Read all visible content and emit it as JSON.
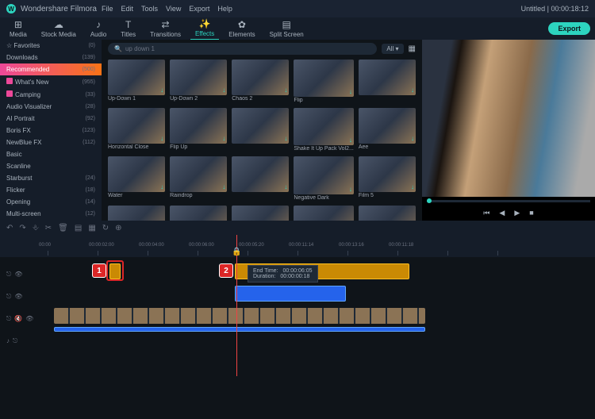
{
  "app_name": "Wondershare Filmora",
  "menu": [
    "File",
    "Edit",
    "Tools",
    "View",
    "Export",
    "Help"
  ],
  "project": {
    "title": "Untitled",
    "duration": "00:00:18:12"
  },
  "tabs": [
    {
      "icon": "⊞",
      "label": "Media"
    },
    {
      "icon": "☁",
      "label": "Stock Media"
    },
    {
      "icon": "♪",
      "label": "Audio"
    },
    {
      "icon": "T",
      "label": "Titles"
    },
    {
      "icon": "⇄",
      "label": "Transitions"
    },
    {
      "icon": "✨",
      "label": "Effects"
    },
    {
      "icon": "✿",
      "label": "Elements"
    },
    {
      "icon": "▤",
      "label": "Split Screen"
    }
  ],
  "export_label": "Export",
  "sidebar": {
    "favorites": "Favorites",
    "favorites_count": "(0)",
    "items": [
      {
        "label": "Downloads",
        "count": "(139)"
      },
      {
        "label": "Recommended",
        "count": "(500)",
        "class": "rec"
      },
      {
        "label": "What's New",
        "count": "(955)",
        "tag": true
      },
      {
        "label": "Camping",
        "count": "(33)",
        "tag": true
      },
      {
        "label": "Audio Visualizer",
        "count": "(28)"
      },
      {
        "label": "AI Portrait",
        "count": "(92)"
      },
      {
        "label": "Boris FX",
        "count": "(123)"
      },
      {
        "label": "NewBlue FX",
        "count": "(112)"
      },
      {
        "label": "Basic",
        "count": ""
      },
      {
        "label": "Scanline",
        "count": ""
      },
      {
        "label": "Starburst",
        "count": "(24)"
      },
      {
        "label": "Flicker",
        "count": "(18)"
      },
      {
        "label": "Opening",
        "count": "(14)"
      },
      {
        "label": "Multi-screen",
        "count": "(12)"
      }
    ]
  },
  "search": {
    "placeholder": "up down 1"
  },
  "filter": "All",
  "effects": [
    "Up-Down 1",
    "Up-Down 2",
    "Chaos 2",
    "Flip",
    "",
    "Horizontal Close",
    "Flip Up",
    "",
    "Shake It Up Pack Vol2...",
    "Aee",
    "Water",
    "Raindrop",
    "",
    "Negative Dark",
    "Film 5",
    "",
    "",
    "",
    "",
    ""
  ],
  "preview": {
    "controls": [
      "⏮",
      "◀",
      "▶",
      "■"
    ]
  },
  "toolbar_icons": [
    "↶",
    "↷",
    "⎀",
    "✂",
    "🗑",
    "▤",
    "▦",
    "↻",
    "⊕"
  ],
  "ruler": [
    "00:00",
    "00:00:02:00",
    "00:00:04:00",
    "00:00:06:00",
    "00:00:05:20",
    "00:00:11:14",
    "00:00:13:16",
    "00:00:11:18",
    "",
    ""
  ],
  "tooltip": {
    "end_time_label": "End Time:",
    "end_time_value": "00:00:06:05",
    "duration_label": "Duration:",
    "duration_value": "00:00:00:18"
  },
  "callouts": {
    "one": "1",
    "two": "2"
  }
}
